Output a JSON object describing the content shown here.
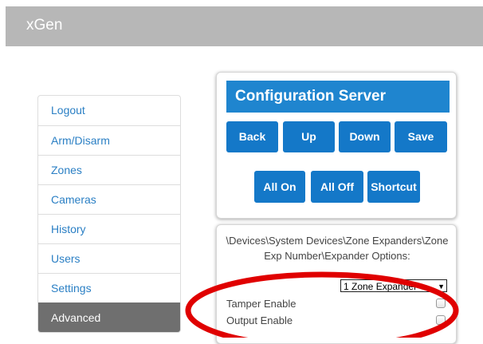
{
  "app": {
    "title": "xGen"
  },
  "sidebar": {
    "items": [
      {
        "label": "Logout"
      },
      {
        "label": "Arm/Disarm"
      },
      {
        "label": "Zones"
      },
      {
        "label": "Cameras"
      },
      {
        "label": "History"
      },
      {
        "label": "Users"
      },
      {
        "label": "Settings"
      },
      {
        "label": "Advanced",
        "active": true
      }
    ]
  },
  "config": {
    "title": "Configuration Server",
    "buttons": {
      "back": "Back",
      "up": "Up",
      "down": "Down",
      "save": "Save",
      "all_on": "All On",
      "all_off": "All Off",
      "shortcut": "Shortcut"
    }
  },
  "details": {
    "path": "\\Devices\\System Devices\\Zone Expanders\\Zone Exp Number\\Expander Options:",
    "expander_select": {
      "value": "1 Zone Expander"
    },
    "options": [
      {
        "label": "Tamper Enable",
        "checked": false
      },
      {
        "label": "Output Enable",
        "checked": false
      }
    ]
  },
  "colors": {
    "header_bg": "#b7b7b7",
    "accent": "#1478c8",
    "title_bg": "#1f85cf",
    "link": "#2a7fc4",
    "active_nav": "#6f6f6f",
    "annotation": "#e00000"
  }
}
